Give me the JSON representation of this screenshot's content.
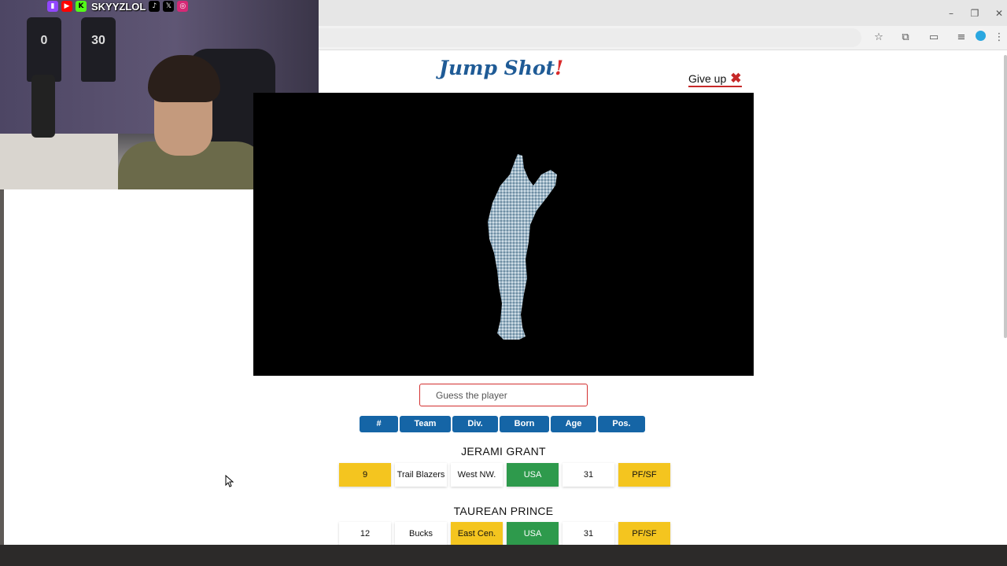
{
  "stream_overlay": {
    "handle": "SKYYZLOL",
    "icons": [
      "twitch-icon",
      "youtube-icon",
      "kick-icon",
      "tiktok-icon",
      "x-icon",
      "instagram-icon"
    ],
    "shirt_numbers": [
      "0",
      "30"
    ]
  },
  "window": {
    "minimize": "–",
    "restore": "❐",
    "close": "✕"
  },
  "game": {
    "logo_text": "Jump Shot",
    "logo_bang": "!",
    "give_up_label": "Give up",
    "give_up_icon": "✖",
    "guess_placeholder": "Guess the player",
    "columns": [
      "#",
      "Team",
      "Div.",
      "Born",
      "Age",
      "Pos."
    ]
  },
  "guesses": [
    {
      "name": "JERAMI GRANT",
      "cells": [
        {
          "value": "9",
          "status": "partial"
        },
        {
          "value": "Trail Blazers",
          "status": "none"
        },
        {
          "value": "West NW.",
          "status": "none"
        },
        {
          "value": "USA",
          "status": "match"
        },
        {
          "value": "31",
          "status": "none"
        },
        {
          "value": "PF/SF",
          "status": "partial"
        }
      ]
    },
    {
      "name": "TAUREAN PRINCE",
      "cells": [
        {
          "value": "12",
          "status": "none"
        },
        {
          "value": "Bucks",
          "status": "none"
        },
        {
          "value": "East Cen.",
          "status": "partial"
        },
        {
          "value": "USA",
          "status": "match"
        },
        {
          "value": "31",
          "status": "none"
        },
        {
          "value": "PF/SF",
          "status": "partial"
        }
      ]
    }
  ],
  "colors": {
    "header_blue": "#1565a6",
    "partial_yellow": "#f4c51f",
    "match_green": "#2e9a4c",
    "logo_blue": "#1f5b96",
    "accent_red": "#d32f2f"
  }
}
